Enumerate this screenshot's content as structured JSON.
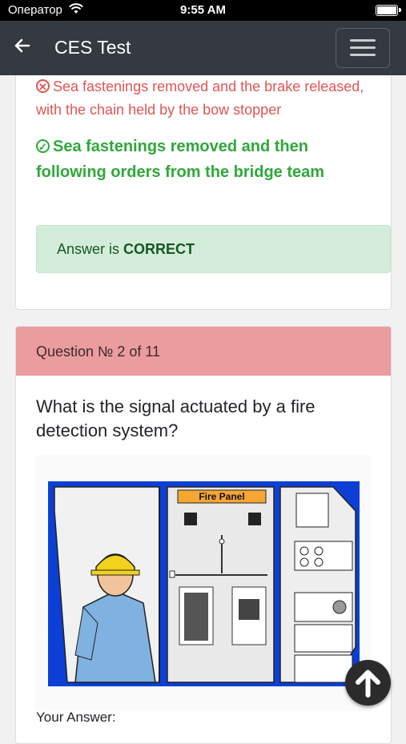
{
  "status": {
    "carrier": "Оператор",
    "time": "9:55 AM"
  },
  "navbar": {
    "title": "CES Test"
  },
  "prev_question": {
    "wrong_option": "Sea fastenings removed and the brake released, with the chain held by the bow stopper",
    "correct_option": "Sea fastenings removed and then following orders from the bridge team",
    "result_prefix": "Answer is ",
    "result_word": "CORRECT"
  },
  "question": {
    "header": "Question № 2 of 11",
    "text": "What is the signal actuated by a fire detection system?",
    "figure_label": "Fire Panel",
    "answer_label": "Your Answer:"
  },
  "colors": {
    "navbar": "#343a40",
    "wrong": "#e05555",
    "correct": "#2fa83a",
    "question_header": "#eb9c9f"
  }
}
